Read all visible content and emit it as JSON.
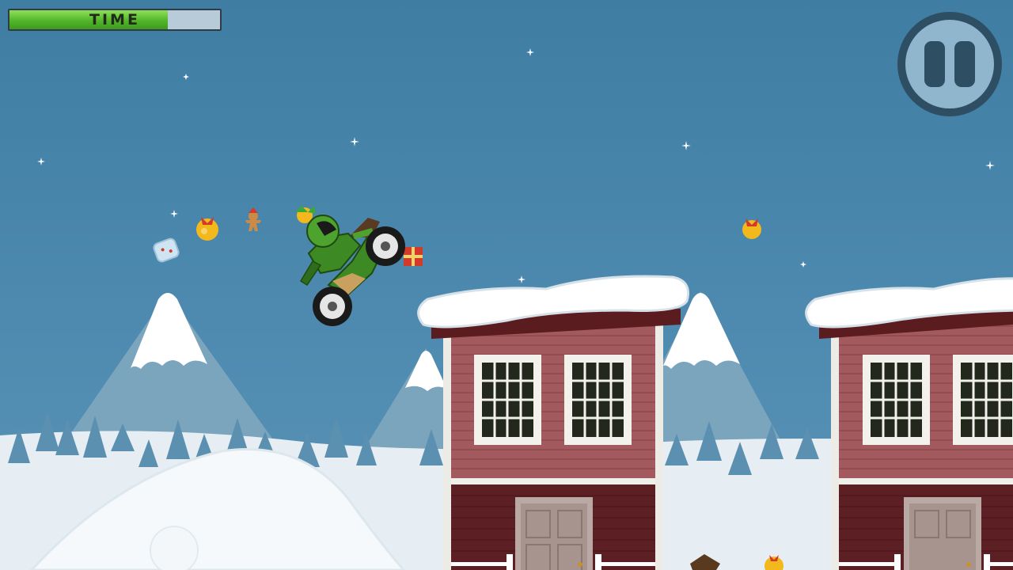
{
  "hud": {
    "time_label": "TIME",
    "time_remaining": 0.75,
    "pause_icon": "pause-icon"
  },
  "colors": {
    "sky": "#4f8bb0",
    "time_fill": "#52b52a",
    "pause_ring": "#2e4e64",
    "house_wall": "#a35a5e",
    "house_base": "#5c2024",
    "bike_green": "#3d8a24"
  }
}
